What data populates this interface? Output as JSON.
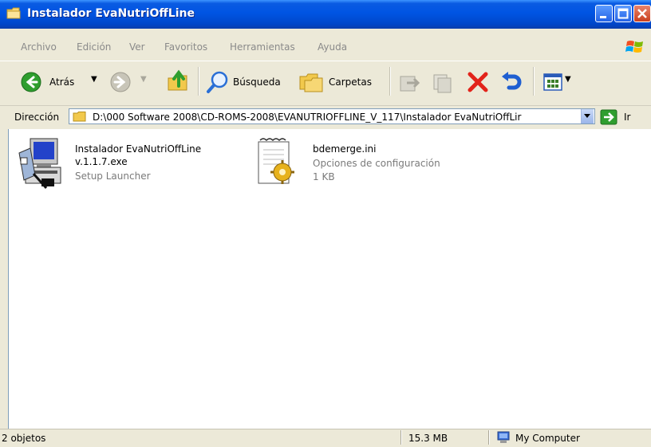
{
  "window": {
    "title": "Instalador EvaNutriOffLine"
  },
  "menu": {
    "items": [
      "Archivo",
      "Edición",
      "Ver",
      "Favoritos",
      "Herramientas",
      "Ayuda"
    ]
  },
  "toolbar": {
    "back_label": "Atrás",
    "search_label": "Búsqueda",
    "folders_label": "Carpetas"
  },
  "address": {
    "label": "Dirección",
    "path": "D:\\000 Software 2008\\CD-ROMS-2008\\EVANUTRIOFFLINE_V_117\\Instalador EvaNutriOffLir",
    "go_label": "Ir"
  },
  "files": [
    {
      "name_line1": "Instalador EvaNutriOffLine",
      "name_line2": "v.1.1.7.exe",
      "type": "Setup Launcher",
      "icon": "setup-installer-icon"
    },
    {
      "name_line1": "bdemerge.ini",
      "type": "Opciones de configuración",
      "size": "1 KB",
      "icon": "ini-config-file-icon"
    }
  ],
  "status": {
    "objects": "2 objetos",
    "size": "15.3 MB",
    "zone": "My Computer"
  },
  "colors": {
    "titlebar": "#0054e3",
    "chrome": "#ece9d8",
    "back_green": "#2f9e2f",
    "delete_red": "#e2231a"
  }
}
